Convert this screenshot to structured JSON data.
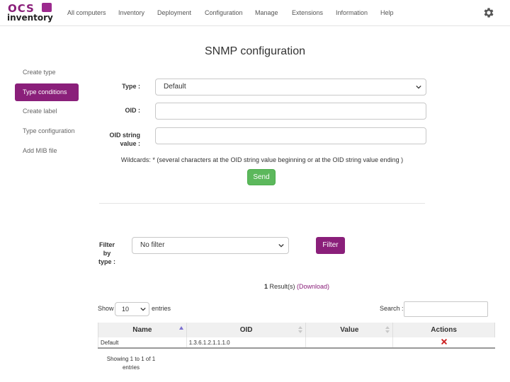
{
  "nav": {
    "logo_top": "OCS",
    "logo_bottom": "inventory",
    "items": [
      "All computers",
      "Inventory",
      "Deployment",
      "Configuration",
      "Manage",
      "Extensions",
      "Information",
      "Help"
    ],
    "settings_icon": "gear-icon"
  },
  "page": {
    "title": "SNMP configuration"
  },
  "sidebar": {
    "items": [
      "Create type",
      "Type conditions",
      "Create label",
      "Type configuration",
      "Add MIB file"
    ],
    "active_index": 1
  },
  "form": {
    "type_label": "Type :",
    "type_value": "Default",
    "oid_label": "OID :",
    "oid_value": "",
    "oid_string_label_1": "OID string",
    "oid_string_label_2": "value :",
    "oid_string_value": "",
    "wildcards": "Wildcards: * (several characters at the OID string value beginning or at the OID string value ending )",
    "send_label": "Send"
  },
  "filter": {
    "label_1": "Filter",
    "label_2": "by",
    "label_3": "type :",
    "value": "No filter",
    "button_label": "Filter"
  },
  "results": {
    "count": "1",
    "text": " Result(s) ",
    "download": "(Download)"
  },
  "table_controls": {
    "show_label": "Show",
    "show_value": "10",
    "entries_label": "entries",
    "search_label": "Search :",
    "search_value": ""
  },
  "table": {
    "columns": [
      "Name",
      "OID",
      "Value",
      "Actions"
    ],
    "rows": [
      {
        "name": "Default",
        "oid": "1.3.6.1.2.1.1.1.0",
        "value": "",
        "action_icon": "delete-icon"
      }
    ]
  },
  "footer_info": {
    "line_1": "Showing 1 to 1 of 1",
    "line_2": "entries"
  },
  "colors": {
    "brand": "#8a1f7a",
    "send_button": "#5cb85c",
    "delete_icon": "#cc2222",
    "sort_active": "#7b6fd0"
  }
}
